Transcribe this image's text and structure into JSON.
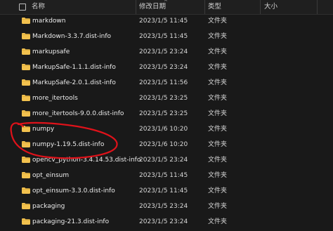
{
  "header": {
    "name_label": "名称",
    "date_label": "修改日期",
    "type_label": "类型",
    "size_label": "大小"
  },
  "rows": [
    {
      "name": "markdown",
      "date": "2023/1/5 11:45",
      "type": "文件夹"
    },
    {
      "name": "Markdown-3.3.7.dist-info",
      "date": "2023/1/5 11:45",
      "type": "文件夹"
    },
    {
      "name": "markupsafe",
      "date": "2023/1/5 23:24",
      "type": "文件夹"
    },
    {
      "name": "MarkupSafe-1.1.1.dist-info",
      "date": "2023/1/5 23:24",
      "type": "文件夹"
    },
    {
      "name": "MarkupSafe-2.0.1.dist-info",
      "date": "2023/1/5 11:56",
      "type": "文件夹"
    },
    {
      "name": "more_itertools",
      "date": "2023/1/5 23:25",
      "type": "文件夹"
    },
    {
      "name": "more_itertools-9.0.0.dist-info",
      "date": "2023/1/5 23:25",
      "type": "文件夹"
    },
    {
      "name": "numpy",
      "date": "2023/1/6 10:20",
      "type": "文件夹"
    },
    {
      "name": "numpy-1.19.5.dist-info",
      "date": "2023/1/6 10:20",
      "type": "文件夹"
    },
    {
      "name": "opencv_python-3.4.14.53.dist-info",
      "date": "2023/1/5 23:24",
      "type": "文件夹"
    },
    {
      "name": "opt_einsum",
      "date": "2023/1/5 11:45",
      "type": "文件夹"
    },
    {
      "name": "opt_einsum-3.3.0.dist-info",
      "date": "2023/1/5 11:45",
      "type": "文件夹"
    },
    {
      "name": "packaging",
      "date": "2023/1/5 23:24",
      "type": "文件夹"
    },
    {
      "name": "packaging-21.3.dist-info",
      "date": "2023/1/5 23:24",
      "type": "文件夹"
    }
  ],
  "colors": {
    "folder": "#f2c14e",
    "folder_shade": "#d9a634",
    "annotation": "#e0121a"
  },
  "icons": {
    "folder": "folder-icon",
    "checkbox": "checkbox-icon",
    "collapse": "chevron-up-icon"
  }
}
